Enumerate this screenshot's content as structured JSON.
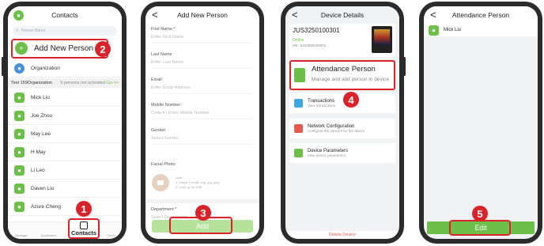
{
  "screen1": {
    "title": "Contacts",
    "search_placeholder": "Person Name",
    "add_label": "Add New Person",
    "org_label": "Organization",
    "org_name": "Test 159Organization",
    "org_status": "9 persons not activated",
    "org_link": "Go >>",
    "people": [
      "Mick Liu",
      "Joe Zhou",
      "May Lee",
      "H May",
      "Li Leo",
      "Daven Liu",
      "Azure Cheng"
    ],
    "tabs": [
      "Message",
      "Application",
      "Contacts",
      "Circle"
    ],
    "badge": "2",
    "badge2": "1"
  },
  "screen2": {
    "title": "Add New Person",
    "fields": [
      {
        "label": "First Name *",
        "placeholder": "Enter First Name"
      },
      {
        "label": "Last Name",
        "placeholder": "Enter Last Name"
      },
      {
        "label": "Email",
        "placeholder": "Enter Email Address"
      },
      {
        "label": "Mobile Number",
        "placeholder": "Code ▾  |  Enter Mobile Number"
      },
      {
        "label": "Gender",
        "placeholder": "Select Gender"
      }
    ],
    "photo_label": "Facial Photo",
    "photo_note_title": "Note:",
    "photo_note_1": "1. Image Format: png, jpg, jpeg",
    "photo_note_2": "2. Limit: up to 2MB",
    "dept_label": "Department *",
    "dept_placeholder": "Select Department",
    "add_button": "Add",
    "badge": "3"
  },
  "screen3": {
    "title": "Device Details",
    "device_id": "JUS3250100301",
    "status": "Online",
    "sn": "SN:   JUS3250100301",
    "attendance_title": "Attendance Person",
    "attendance_sub": "Manage and add person in device",
    "rows": [
      {
        "title": "Transactions",
        "sub": "View transactions"
      },
      {
        "title": "Network Configuration",
        "sub": "Configure the network for the device"
      },
      {
        "title": "Device Parameters",
        "sub": "View device parameters"
      }
    ],
    "delete_label": "Delete Device",
    "badge": "4"
  },
  "screen4": {
    "title": "Attendance Person",
    "person": "Mick Liu",
    "edit_button": "Edit",
    "badge": "5"
  },
  "colors": {
    "accent": "#6cc04a",
    "highlight": "#d8232a"
  }
}
